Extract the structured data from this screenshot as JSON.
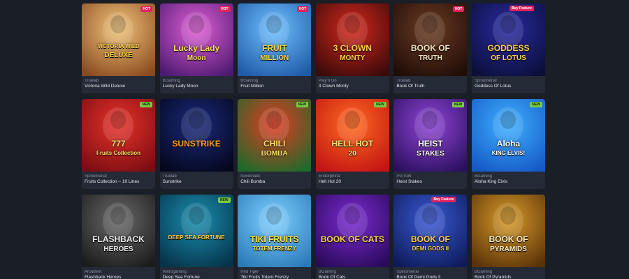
{
  "badges": {
    "hot": "HOT",
    "new": "NEW",
    "buy": "Buy Feature"
  },
  "games": [
    {
      "provider": "Truelab",
      "name": "Victoria Wild Deluxe",
      "title": "VICTORIA WILD",
      "subtitle": "DELUXE",
      "badge": "hot",
      "bg": [
        "#f0c47a",
        "#8a4a1f"
      ],
      "tc": "#ffd24a"
    },
    {
      "provider": "BGaming",
      "name": "Lucky Lady Moon",
      "title": "Lucky Lady",
      "subtitle": "Moon",
      "badge": "hot",
      "bg": [
        "#e05fd6",
        "#4d1a70"
      ],
      "tc": "#ffe25a"
    },
    {
      "provider": "BGaming",
      "name": "Fruit Million",
      "title": "FRUIT",
      "subtitle": "MILLION",
      "badge": "hot",
      "bg": [
        "#6fc0ff",
        "#1f5aa8"
      ],
      "tc": "#ffd84a"
    },
    {
      "provider": "Play'n Go",
      "name": "3 Clown Monty",
      "title": "3 CLOWN",
      "subtitle": "MONTY",
      "badge": "",
      "bg": [
        "#d2281c",
        "#3b0a0a"
      ],
      "tc": "#ffd24a"
    },
    {
      "provider": "Truelab",
      "name": "Book Of Truth",
      "title": "BOOK OF",
      "subtitle": "TRUTH",
      "badge": "hot",
      "bg": [
        "#6b3a22",
        "#200d08"
      ],
      "tc": "#f4e3c0"
    },
    {
      "provider": "Spinomenal",
      "name": "Goddess Of Lotus",
      "title": "GODDESS",
      "subtitle": "OF LOTUS",
      "badge": "buy",
      "bg": [
        "#2a2aa0",
        "#0b0f3a"
      ],
      "tc": "#ffd54a"
    },
    {
      "provider": "Spinomenal",
      "name": "Fruits Collection – 10 Lines",
      "title": "777",
      "subtitle": "Fruits Collection",
      "badge": "new",
      "bg": [
        "#e8322a",
        "#7a0d12"
      ],
      "tc": "#ffe066"
    },
    {
      "provider": "Truelab",
      "name": "Sunstrike",
      "title": "SUNSTRIKE",
      "subtitle": "",
      "badge": "",
      "bg": [
        "#1a2a7a",
        "#05071e"
      ],
      "tc": "#ff9a2a"
    },
    {
      "provider": "Novomatic",
      "name": "Chili Bomba",
      "title": "CHILI",
      "subtitle": "BOMBA",
      "badge": "new",
      "bg": [
        "#e23a22",
        "#1d6b2a"
      ],
      "tc": "#ffe36a"
    },
    {
      "provider": "Endorphina",
      "name": "Hell Hot 20",
      "title": "HELL HOT",
      "subtitle": "20",
      "badge": "new",
      "bg": [
        "#ff6a1f",
        "#c21414"
      ],
      "tc": "#ffe66a"
    },
    {
      "provider": "PG Soft",
      "name": "Heist Stakes",
      "title": "HEIST",
      "subtitle": "STAKES",
      "badge": "new",
      "bg": [
        "#8f45d6",
        "#2c1060"
      ],
      "tc": "#ffffff"
    },
    {
      "provider": "BGaming",
      "name": "Aloha King Elvis",
      "title": "Aloha",
      "subtitle": "KING ELVIS!",
      "badge": "new",
      "bg": [
        "#3fb0ff",
        "#1559c6"
      ],
      "tc": "#ffffff"
    },
    {
      "provider": "Arcadem",
      "name": "Flashback Heroes",
      "title": "FLASHBACK",
      "subtitle": "HEROES",
      "badge": "",
      "bg": [
        "#6a6a6a",
        "#1b1b1b"
      ],
      "tc": "#e8e8e8"
    },
    {
      "provider": "Retrogaming",
      "name": "Deep Sea Fortune",
      "title": "DEEP SEA FORTUNE",
      "subtitle": "",
      "badge": "new",
      "bg": [
        "#1a8fb0",
        "#06334a"
      ],
      "tc": "#ffd24a"
    },
    {
      "provider": "Red Tiger",
      "name": "Tiki Fruits Totem Frenzy",
      "title": "TIKI FRUITS",
      "subtitle": "TOTEM FRENZY",
      "badge": "",
      "bg": [
        "#7fd0ff",
        "#2a7ab8"
      ],
      "tc": "#ffe24a"
    },
    {
      "provider": "BGaming",
      "name": "Book Of Cats",
      "title": "BOOK OF CATS",
      "subtitle": "",
      "badge": "",
      "bg": [
        "#7b2ad1",
        "#2a0a5a"
      ],
      "tc": "#ffd24a"
    },
    {
      "provider": "Spinomenal",
      "name": "Book Of Demi Gods II",
      "title": "BOOK OF",
      "subtitle": "DEMI GODS II",
      "badge": "buy",
      "bg": [
        "#3a5ad6",
        "#0e1b5a"
      ],
      "tc": "#ffd24a"
    },
    {
      "provider": "BGaming",
      "name": "Book Of Pyramids",
      "title": "BOOK OF",
      "subtitle": "PYRAMIDS",
      "badge": "",
      "bg": [
        "#d79a2a",
        "#5a3208"
      ],
      "tc": "#fff2c0"
    }
  ]
}
